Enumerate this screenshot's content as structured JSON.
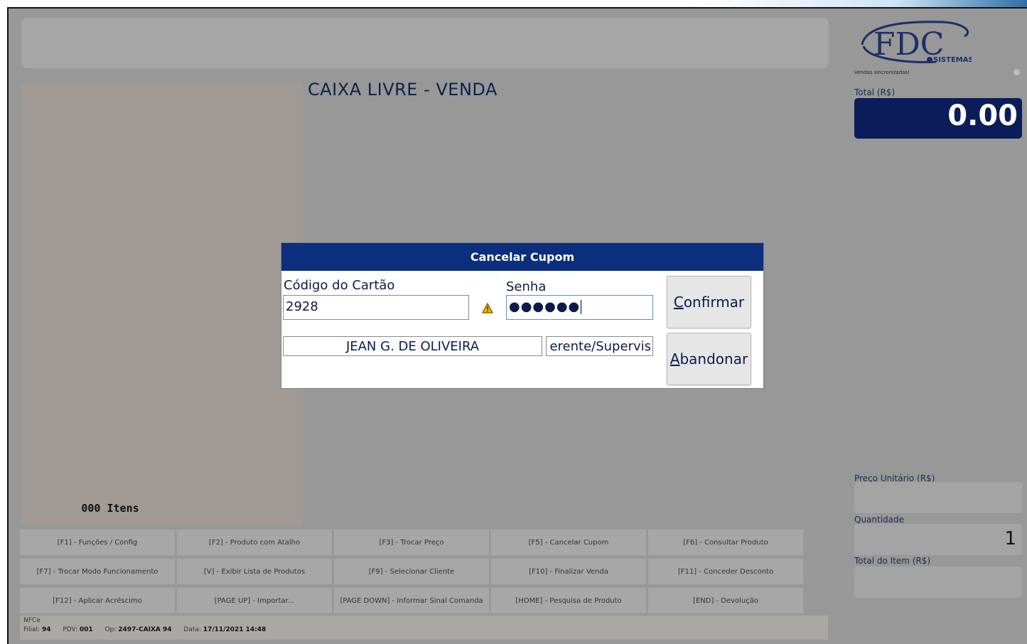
{
  "status": {
    "title": "CAIXA LIVRE - VENDA"
  },
  "items": {
    "count_label": "000 Itens"
  },
  "brand": {
    "logo_text": "FDC",
    "logo_sub": "SISTEMAS"
  },
  "sync": {
    "text": "Vendas sincronizadas!"
  },
  "totals": {
    "total_label": "Total (R$)",
    "total_value": "0.00",
    "unit_price_label": "Preço Unitário (R$)",
    "unit_price_value": "",
    "quantity_label": "Quantidade",
    "quantity_value": "1",
    "item_total_label": "Total do Item (R$)",
    "item_total_value": ""
  },
  "function_keys": [
    "[F1] - Funções / Config",
    "[F2] - Produto com Atalho",
    "[F3] - Trocar Preço",
    "[F5] - Cancelar Cupom",
    "[F6] - Consultar Produto",
    "[F7] - Trocar Modo Funcionamento",
    "[V] - Exibir Lista de Produtos",
    "[F9] - Selecionar Cliente",
    "[F10] - Finalizar Venda",
    "[F11] - Conceder Desconto",
    "[F12] - Aplicar Acréscimo",
    "[PAGE UP] - Importar...",
    "[PAGE DOWN] - Informar Sinal Comanda",
    "[HOME] - Pesquisa de Produto",
    "[END] - Devolução"
  ],
  "footer": {
    "doc_type": "NFCe",
    "filial_label": "Filial:",
    "filial_value": "94",
    "pdv_label": "PDV:",
    "pdv_value": "001",
    "op_label": "Op:",
    "op_value": "2497-CAIXA 94",
    "data_label": "Data:",
    "data_value": "17/11/2021  14:48"
  },
  "dialog": {
    "title": "Cancelar Cupom",
    "card_code_label": "Código do Cartão",
    "card_code_value": "2928",
    "password_label": "Senha",
    "password_value": "●●●●●●",
    "user_name": "JEAN G. DE OLIVEIRA",
    "user_role": "erente/Supervis",
    "confirm_label_first": "C",
    "confirm_label_rest": "onfirmar",
    "abandon_label_first": "A",
    "abandon_label_rest": "bandonar"
  }
}
